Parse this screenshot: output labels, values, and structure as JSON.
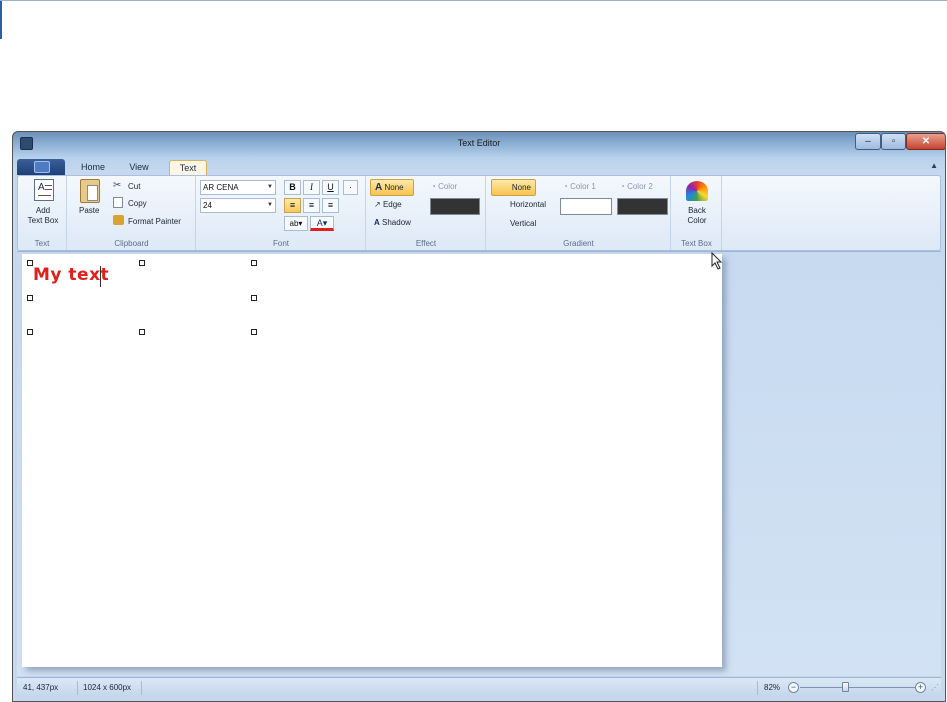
{
  "window": {
    "title": "Text Editor"
  },
  "tabs": [
    "Home",
    "View",
    "Text"
  ],
  "ribbon": {
    "text_group": {
      "label": "Text",
      "add_text_box": "Add\nText Box"
    },
    "clipboard": {
      "label": "Clipboard",
      "paste": "Paste",
      "cut": "Cut",
      "copy": "Copy",
      "format_painter": "Format Painter"
    },
    "font": {
      "label": "Font",
      "font_name": "AR CENA",
      "font_size": "24",
      "bold": "B",
      "italic": "I",
      "underline": "U"
    },
    "effect": {
      "label": "Effect",
      "none": "None",
      "edge": "Edge",
      "shadow": "Shadow",
      "color": "Color",
      "color_swatch": "#333333"
    },
    "gradient": {
      "label": "Gradient",
      "none": "None",
      "horizontal": "Horizontal",
      "vertical": "Vertical",
      "color1": "Color 1",
      "color2": "Color 2",
      "color1_swatch": "#ffffff",
      "color2_swatch": "#333333"
    },
    "textbox": {
      "label": "Text Box",
      "back_color": "Back\nColor"
    }
  },
  "document": {
    "text": "My text",
    "text_color": "#e0201a"
  },
  "status": {
    "position": "41, 437px",
    "size": "1024 x 600px",
    "zoom": "82%"
  }
}
